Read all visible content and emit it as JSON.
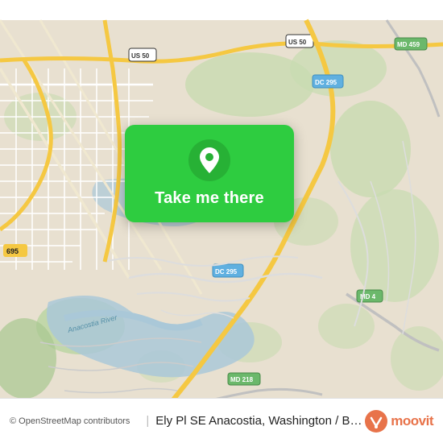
{
  "map": {
    "background_color": "#e8e0d8",
    "alt": "Map of Washington DC / Baltimore area showing Anacostia"
  },
  "card": {
    "button_label": "Take me there",
    "background_color": "#2ecc40"
  },
  "bottom_bar": {
    "attribution": "© OpenStreetMap contributors",
    "location_name": "Ely Pl SE Anacostia, Washington / Baltimore",
    "moovit_label": "moovit"
  }
}
